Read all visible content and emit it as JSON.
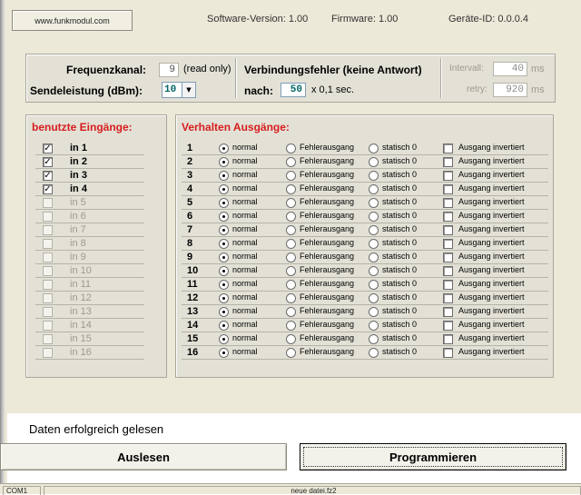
{
  "topbar": {
    "url_button": "www.funkmodul.com",
    "software_version": "Software-Version:  1.00",
    "firmware": "Firmware:  1.00",
    "device_id": "Geräte-ID: 0.0.0.4"
  },
  "settings": {
    "frequency_label": "Frequenzkanal:",
    "frequency_value": "9",
    "read_only_note": "(read only)",
    "power_label": "Sendeleistung (dBm):",
    "power_value": "10",
    "conn_error_label": "Verbindungsfehler (keine Antwort)",
    "after_label": "nach:",
    "after_value": "50",
    "after_unit": "x 0,1 sec.",
    "interval_label": "Intervall:",
    "interval_value": "40",
    "interval_unit": "ms",
    "retry_label": "retry:",
    "retry_value": "920",
    "retry_unit": "ms"
  },
  "inputs": {
    "title": "benutzte Eingänge:",
    "items": [
      {
        "label": "in 1",
        "checked": true
      },
      {
        "label": "in 2",
        "checked": true
      },
      {
        "label": "in 3",
        "checked": true
      },
      {
        "label": "in 4",
        "checked": true
      },
      {
        "label": "in 5",
        "checked": false
      },
      {
        "label": "in 6",
        "checked": false
      },
      {
        "label": "in 7",
        "checked": false
      },
      {
        "label": "in 8",
        "checked": false
      },
      {
        "label": "in 9",
        "checked": false
      },
      {
        "label": "in 10",
        "checked": false
      },
      {
        "label": "in 11",
        "checked": false
      },
      {
        "label": "in 12",
        "checked": false
      },
      {
        "label": "in 13",
        "checked": false
      },
      {
        "label": "in 14",
        "checked": false
      },
      {
        "label": "in 15",
        "checked": false
      },
      {
        "label": "in 16",
        "checked": false
      }
    ]
  },
  "outputs": {
    "title": "Verhalten Ausgänge:",
    "option_normal": "normal",
    "option_error": "Fehlerausgang",
    "option_static": "statisch 0",
    "invert_label": "Ausgang invertiert",
    "rows": [
      {
        "num": "1",
        "mode": "normal",
        "inverted": false
      },
      {
        "num": "2",
        "mode": "normal",
        "inverted": false
      },
      {
        "num": "3",
        "mode": "normal",
        "inverted": false
      },
      {
        "num": "4",
        "mode": "normal",
        "inverted": false
      },
      {
        "num": "5",
        "mode": "normal",
        "inverted": false
      },
      {
        "num": "6",
        "mode": "normal",
        "inverted": false
      },
      {
        "num": "7",
        "mode": "normal",
        "inverted": false
      },
      {
        "num": "8",
        "mode": "normal",
        "inverted": false
      },
      {
        "num": "9",
        "mode": "normal",
        "inverted": false
      },
      {
        "num": "10",
        "mode": "normal",
        "inverted": false
      },
      {
        "num": "11",
        "mode": "normal",
        "inverted": false
      },
      {
        "num": "12",
        "mode": "normal",
        "inverted": false
      },
      {
        "num": "13",
        "mode": "normal",
        "inverted": false
      },
      {
        "num": "14",
        "mode": "normal",
        "inverted": false
      },
      {
        "num": "15",
        "mode": "normal",
        "inverted": false
      },
      {
        "num": "16",
        "mode": "normal",
        "inverted": false
      }
    ]
  },
  "status_message": "Daten erfolgreich gelesen",
  "buttons": {
    "read": "Auslesen",
    "program": "Programmieren"
  },
  "statusbar": {
    "port": "COM1",
    "file": "neue datei.fz2"
  },
  "colors": {
    "section_title": "#d71d1d",
    "panel_bg": "#ece9d8",
    "group_bg": "#e3e1d6",
    "dropdown_text": "#006666"
  },
  "icons": {
    "dropdown": "chevron-down-icon",
    "check": "checkmark-icon"
  }
}
